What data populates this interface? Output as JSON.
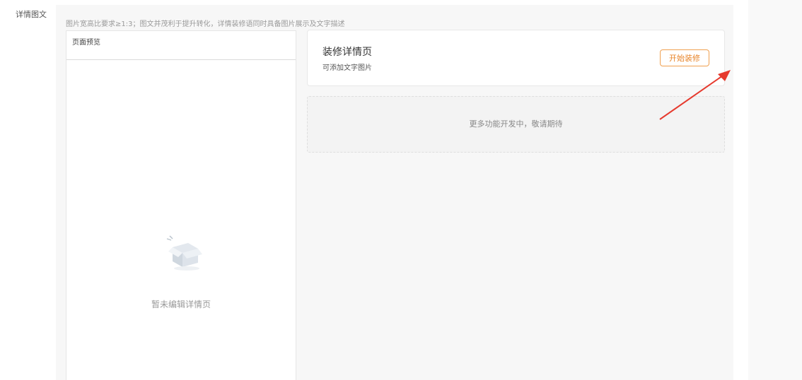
{
  "form": {
    "field_label": "详情图文"
  },
  "panel": {
    "hint": "图片宽高比要求≥1:3；图文并茂利于提升转化，详情装修语同时具备图片展示及文字描述"
  },
  "preview": {
    "title": "页面预览",
    "empty_text": "暂未编辑详情页",
    "empty_icon": "empty-box-icon"
  },
  "decor_card": {
    "title": "装修详情页",
    "subtitle": "可添加文字图片",
    "button_label": "开始装修",
    "accent_color": "#e8852a"
  },
  "coming_soon": {
    "text": "更多功能开发中，敬请期待"
  },
  "annotation": {
    "arrow_color": "#e63a2e"
  }
}
